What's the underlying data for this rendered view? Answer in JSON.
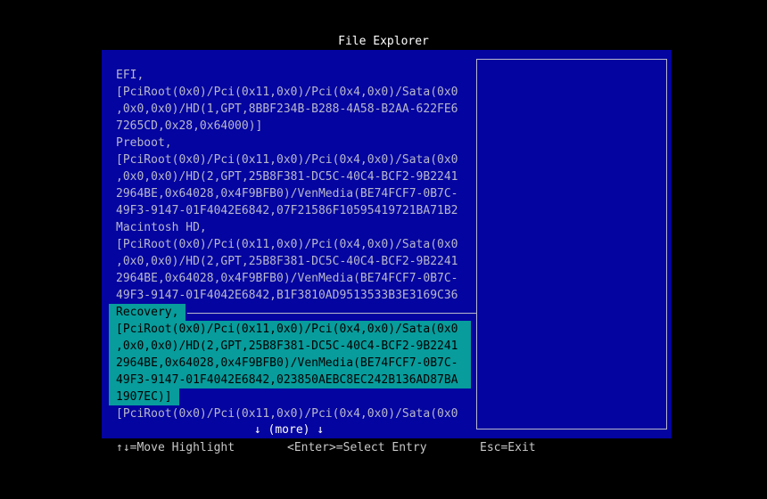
{
  "title": "File Explorer",
  "entries": [
    {
      "label": "EFI,",
      "path_lines": [
        "[PciRoot(0x0)/Pci(0x11,0x0)/Pci(0x4,0x0)/Sata(0x0",
        ",0x0,0x0)/HD(1,GPT,8BBF234B-B288-4A58-B2AA-622FE6",
        "7265CD,0x28,0x64000)]"
      ],
      "selected": false
    },
    {
      "label": "Preboot,",
      "path_lines": [
        "[PciRoot(0x0)/Pci(0x11,0x0)/Pci(0x4,0x0)/Sata(0x0",
        ",0x0,0x0)/HD(2,GPT,25B8F381-DC5C-40C4-BCF2-9B2241",
        "2964BE,0x64028,0x4F9BFB0)/VenMedia(BE74FCF7-0B7C-",
        "49F3-9147-01F4042E6842,07F21586F10595419721BA71B2"
      ],
      "selected": false
    },
    {
      "label": "Macintosh HD,",
      "path_lines": [
        "[PciRoot(0x0)/Pci(0x11,0x0)/Pci(0x4,0x0)/Sata(0x0",
        ",0x0,0x0)/HD(2,GPT,25B8F381-DC5C-40C4-BCF2-9B2241",
        "2964BE,0x64028,0x4F9BFB0)/VenMedia(BE74FCF7-0B7C-",
        "49F3-9147-01F4042E6842,B1F3810AD9513533B3E3169C36"
      ],
      "selected": false
    },
    {
      "label": "Recovery,",
      "path_lines": [
        "[PciRoot(0x0)/Pci(0x11,0x0)/Pci(0x4,0x0)/Sata(0x0",
        ",0x0,0x0)/HD(2,GPT,25B8F381-DC5C-40C4-BCF2-9B2241",
        "2964BE,0x64028,0x4F9BFB0)/VenMedia(BE74FCF7-0B7C-",
        "49F3-9147-01F4042E6842,023850AEBC8EC242B136AD87BA",
        "1907EC)]"
      ],
      "selected": true
    },
    {
      "label": null,
      "path_lines": [
        "[PciRoot(0x0)/Pci(0x11,0x0)/Pci(0x4,0x0)/Sata(0x0"
      ],
      "selected": false
    }
  ],
  "more_indicator": "↓ (more) ↓",
  "footer": {
    "move": "↑↓=Move Highlight",
    "select": "<Enter>=Select Entry",
    "exit": "Esc=Exit"
  },
  "colors": {
    "panel": "#0404a0",
    "highlight": "#089c9c",
    "text": "#b8b8cc"
  }
}
